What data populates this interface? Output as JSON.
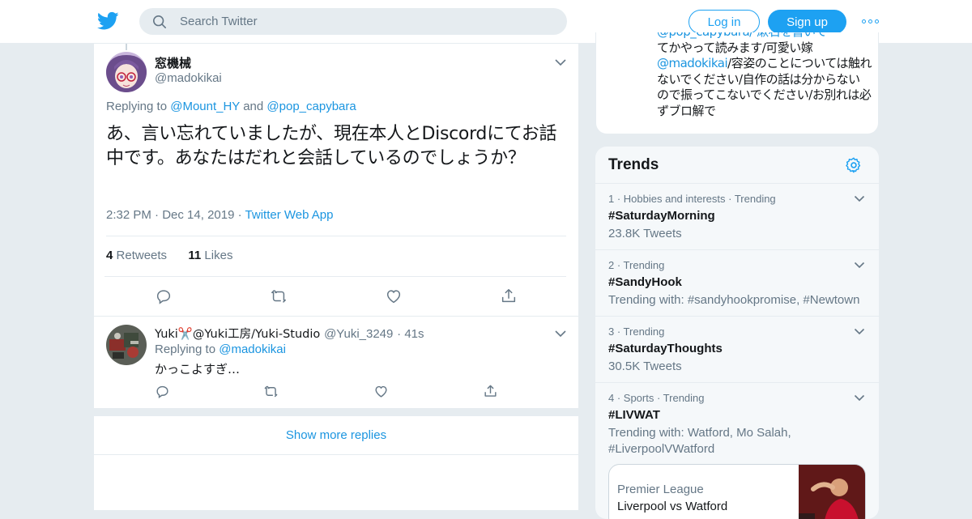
{
  "header": {
    "search_placeholder": "Search Twitter",
    "login_label": "Log in",
    "signup_label": "Sign up",
    "brand_color": "#1da1f2"
  },
  "main_tweet": {
    "name": "窓機械",
    "handle": "@madokikai",
    "replying_prefix": "Replying to",
    "replying_user1": "@Mount_HY",
    "replying_and": "and",
    "replying_user2": "@pop_capybara",
    "text": "あ、言い忘れていましたが、現在本人とDiscordにてお話中です。あなたはだれと会話しているのでしょうか？",
    "time": "2:32 PM",
    "date": "Dec 14, 2019",
    "source": "Twitter Web App",
    "retweets_count": "4",
    "retweets_label": "Retweets",
    "likes_count": "11",
    "likes_label": "Likes"
  },
  "reply": {
    "name": "Yuki✂️@Yuki工房/Yuki-Studio",
    "handle": "@Yuki_3249",
    "time": "41s",
    "replying_prefix": "Replying to",
    "replying_user": "@madokikai",
    "text": "かっこよすぎ…"
  },
  "show_more_label": "Show more replies",
  "bio_card": {
    "line_cut": "@pop_capybara/ 漱石を書いて",
    "text_rest": "てかやって読みます/可愛い嫁",
    "mention": "@madokikai",
    "text_after": "/容姿のことについては触れないでください/自作の話は分からないので振ってこないでください/お別れは必ずブロ解で"
  },
  "trends": {
    "title": "Trends",
    "items": [
      {
        "ctx": "1 · Hobbies and interests · Trending",
        "name": "#SaturdayMorning",
        "sub": "23.8K Tweets"
      },
      {
        "ctx": "2 · Trending",
        "name": "#SandyHook",
        "sub": "Trending with: #sandyhookpromise, #Newtown"
      },
      {
        "ctx": "3 · Trending",
        "name": "#SaturdayThoughts",
        "sub": "30.5K Tweets"
      },
      {
        "ctx": "4 · Sports · Trending",
        "name": "#LIVWAT",
        "sub": "Trending with: Watford, Mo Salah, #LiverpoolVWatford"
      }
    ],
    "event": {
      "category": "Premier League",
      "title": "Liverpool vs Watford"
    }
  }
}
